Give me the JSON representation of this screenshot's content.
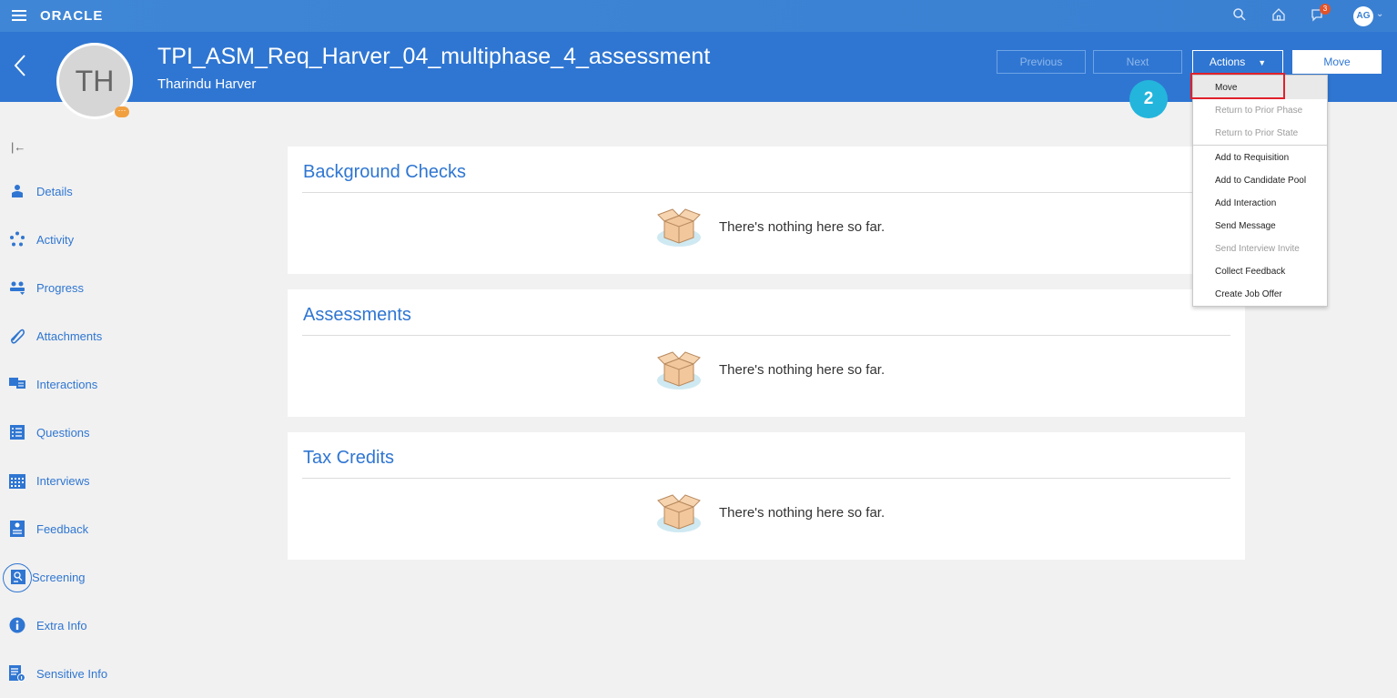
{
  "topbar": {
    "logo": "ORACLE",
    "notifications_count": "3",
    "user_initials": "AG"
  },
  "header": {
    "title": "TPI_ASM_Req_Harver_04_multiphase_4_assessment",
    "candidate_name": "Tharindu Harver",
    "avatar_initials": "TH",
    "buttons": {
      "previous": "Previous",
      "next": "Next",
      "actions": "Actions",
      "move": "Move"
    }
  },
  "actions_menu": {
    "items": [
      {
        "label": "Move",
        "enabled": true
      },
      {
        "label": "Return to Prior Phase",
        "enabled": false
      },
      {
        "label": "Return to Prior State",
        "enabled": false
      },
      {
        "label": "Add to Requisition",
        "enabled": true
      },
      {
        "label": "Add to Candidate Pool",
        "enabled": true
      },
      {
        "label": "Add Interaction",
        "enabled": true
      },
      {
        "label": "Send Message",
        "enabled": true
      },
      {
        "label": "Send Interview Invite",
        "enabled": false
      },
      {
        "label": "Collect Feedback",
        "enabled": true
      },
      {
        "label": "Create Job Offer",
        "enabled": true
      }
    ]
  },
  "step_marker": "2",
  "sidebar": {
    "items": [
      {
        "label": "Details",
        "icon": "person-icon"
      },
      {
        "label": "Activity",
        "icon": "activity-icon"
      },
      {
        "label": "Progress",
        "icon": "progress-icon"
      },
      {
        "label": "Attachments",
        "icon": "paperclip-icon"
      },
      {
        "label": "Interactions",
        "icon": "interactions-icon"
      },
      {
        "label": "Questions",
        "icon": "questions-icon"
      },
      {
        "label": "Interviews",
        "icon": "calendar-icon"
      },
      {
        "label": "Feedback",
        "icon": "feedback-icon"
      },
      {
        "label": "Screening",
        "icon": "screening-icon"
      },
      {
        "label": "Extra Info",
        "icon": "info-icon"
      },
      {
        "label": "Sensitive Info",
        "icon": "sensitive-info-icon"
      }
    ]
  },
  "sections": [
    {
      "title": "Background Checks",
      "empty_text": "There's nothing here so far."
    },
    {
      "title": "Assessments",
      "empty_text": "There's nothing here so far."
    },
    {
      "title": "Tax Credits",
      "empty_text": "There's nothing here so far."
    }
  ],
  "colors": {
    "brand_blue": "#2f76d2",
    "highlight_red": "#e0202a",
    "step_cyan": "#23b5dc"
  }
}
